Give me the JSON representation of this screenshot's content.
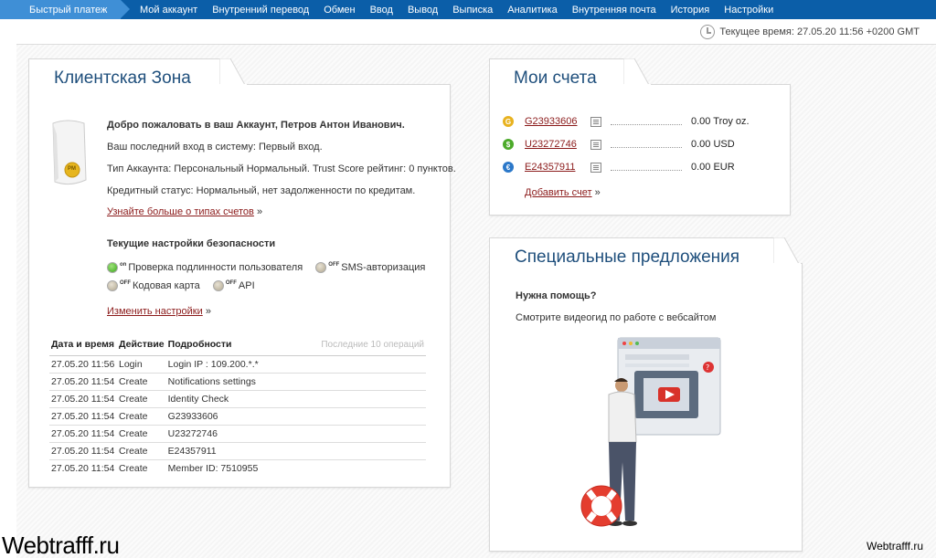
{
  "nav": {
    "quick": "Быстрый платеж",
    "items": [
      "Мой аккаунт",
      "Внутренний перевод",
      "Обмен",
      "Ввод",
      "Вывод",
      "Выписка",
      "Аналитика",
      "Внутренняя почта",
      "История",
      "Настройки"
    ]
  },
  "time": "Текущее время: 27.05.20 11:56 +0200 GMT",
  "client": {
    "title": "Клиентская Зона",
    "welcome": "Добро пожаловать в ваш Аккаунт, Петров Антон Иванович.",
    "last_login": "Ваш последний вход в систему: Первый вход.",
    "account_type": "Тип Аккаунта: Персональный Нормальный. Trust Score рейтинг: 0 пунктов.",
    "credit": "Кредитный статус: Нормальный, нет задолженности по кредитам.",
    "learn_more": "Узнайте больше о типах счетов",
    "security_title": "Текущие настройки безопасности",
    "settings": [
      {
        "label": "Проверка подлинности пользователя",
        "state": "on"
      },
      {
        "label": "SMS-авторизация",
        "state": "OFF"
      },
      {
        "label": "Кодовая карта",
        "state": "OFF"
      },
      {
        "label": "API",
        "state": "OFF"
      }
    ],
    "change_settings": "Изменить настройки",
    "arrow": "»",
    "badge": "PM"
  },
  "log": {
    "headers": [
      "Дата и время",
      "Действие",
      "Подробности"
    ],
    "note": "Последние 10 операций",
    "rows": [
      [
        "27.05.20 11:56",
        "Login",
        "Login IP : 109.200.*.*"
      ],
      [
        "27.05.20 11:54",
        "Create",
        "Notifications settings"
      ],
      [
        "27.05.20 11:54",
        "Create",
        "Identity Check"
      ],
      [
        "27.05.20 11:54",
        "Create",
        "G23933606"
      ],
      [
        "27.05.20 11:54",
        "Create",
        "U23272746"
      ],
      [
        "27.05.20 11:54",
        "Create",
        "E24357911"
      ],
      [
        "27.05.20 11:54",
        "Create",
        "Member ID: 7510955"
      ]
    ]
  },
  "accounts": {
    "title": "Мои счета",
    "items": [
      {
        "id": "G23933606",
        "amount": "0.00 Troy oz.",
        "coin": "G",
        "color": "#e8b21f"
      },
      {
        "id": "U23272746",
        "amount": "0.00 USD",
        "coin": "$",
        "color": "#4caa2a"
      },
      {
        "id": "E24357911",
        "amount": "0.00 EUR",
        "coin": "€",
        "color": "#2b78c9"
      }
    ],
    "add": "Добавить счет"
  },
  "offers": {
    "title": "Специальные предложения",
    "help_title": "Нужна помощь?",
    "help_text": "Смотрите видеогид по работе с вебсайтом"
  },
  "watermark": "Webtrafff.ru",
  "colors": {
    "nav_bg": "#0b5ea8",
    "quick_bg": "#3f8fd6",
    "title": "#1f4f7c",
    "link": "#8b1a1a"
  }
}
